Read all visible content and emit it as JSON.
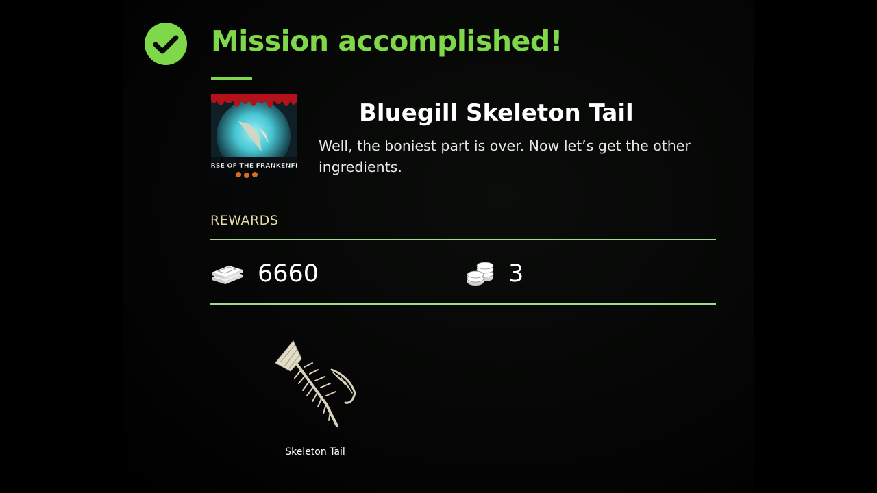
{
  "header": {
    "title": "Mission accomplished!",
    "icon": "check-circle-icon",
    "accent_color": "#7ed84a"
  },
  "mission": {
    "art_text": "CURSE OF THE FRANKENFISH",
    "name": "Bluegill Skeleton Tail",
    "description": "Well, the boniest part is over. Now let’s get the other ingredients."
  },
  "rewards": {
    "label": "REWARDS",
    "money": {
      "icon": "cash-stack-icon",
      "value": "6660"
    },
    "coins": {
      "icon": "coin-stack-icon",
      "value": "3"
    }
  },
  "item": {
    "icon": "fish-skeleton-tail-icon",
    "label": "Skeleton Tail"
  }
}
